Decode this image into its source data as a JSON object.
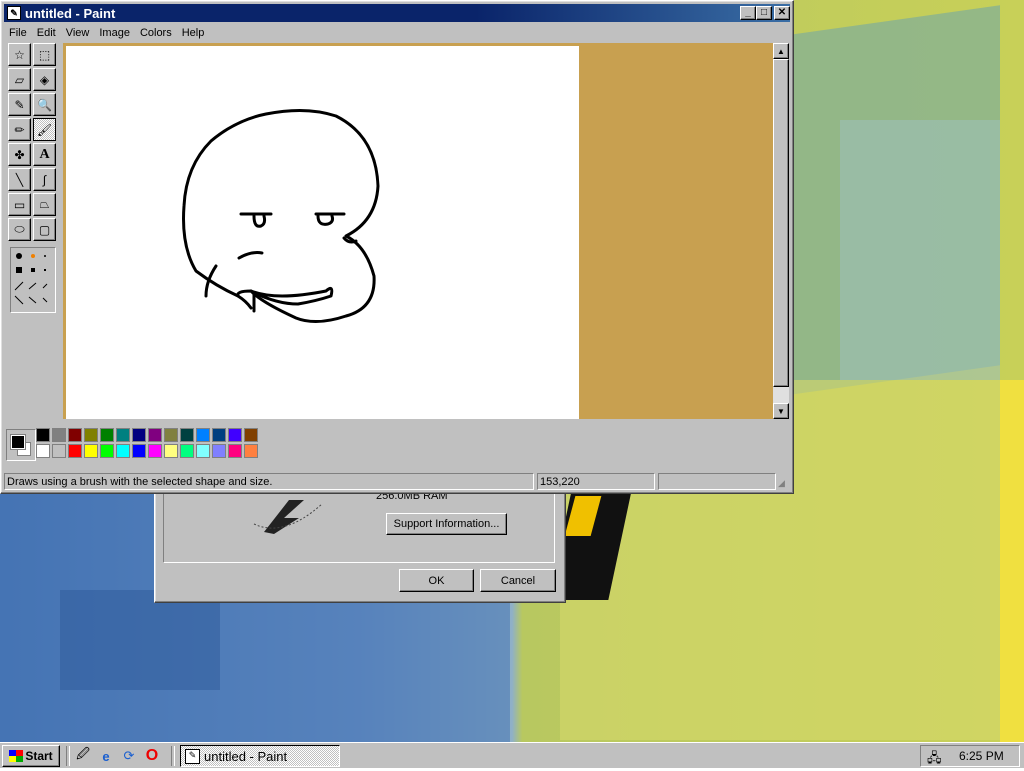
{
  "window": {
    "title": "untitled - Paint",
    "minimize_glyph": "_",
    "maximize_glyph": "□",
    "close_glyph": "✕"
  },
  "menu": [
    "File",
    "Edit",
    "View",
    "Image",
    "Colors",
    "Help"
  ],
  "tools": [
    {
      "name": "free-form-select",
      "glyph": "☆"
    },
    {
      "name": "select",
      "glyph": "⬚"
    },
    {
      "name": "eraser",
      "glyph": "▱"
    },
    {
      "name": "fill-with-color",
      "glyph": "◈"
    },
    {
      "name": "pick-color",
      "glyph": "✎"
    },
    {
      "name": "magnifier",
      "glyph": "🔍"
    },
    {
      "name": "pencil",
      "glyph": "✏"
    },
    {
      "name": "brush",
      "glyph": "🖌"
    },
    {
      "name": "airbrush",
      "glyph": "✤"
    },
    {
      "name": "text",
      "glyph": "A"
    },
    {
      "name": "line",
      "glyph": "╲"
    },
    {
      "name": "curve",
      "glyph": "∫"
    },
    {
      "name": "rectangle",
      "glyph": "▭"
    },
    {
      "name": "polygon",
      "glyph": "⏢"
    },
    {
      "name": "ellipse",
      "glyph": "⬭"
    },
    {
      "name": "rounded-rectangle",
      "glyph": "▢"
    }
  ],
  "palette": {
    "primary": "#000000",
    "secondary": "#ffffff",
    "row1": [
      "#000000",
      "#808080",
      "#800000",
      "#808000",
      "#008000",
      "#008080",
      "#000080",
      "#800080",
      "#808040",
      "#004040",
      "#0080ff",
      "#004080",
      "#4000ff",
      "#804000"
    ],
    "row2": [
      "#ffffff",
      "#c0c0c0",
      "#ff0000",
      "#ffff00",
      "#00ff00",
      "#00ffff",
      "#0000ff",
      "#ff00ff",
      "#ffff80",
      "#00ff80",
      "#80ffff",
      "#8080ff",
      "#ff0080",
      "#ff8040"
    ]
  },
  "status": {
    "help_text": "Draws using a brush with the selected shape and size.",
    "coordinates": "153,220",
    "size": ""
  },
  "dialog": {
    "partial_text": "256.0MB RAM",
    "support_button": "Support Information...",
    "ok_button": "OK",
    "cancel_button": "Cancel"
  },
  "taskbar": {
    "start_label": "Start",
    "task_label": "untitled - Paint",
    "clock": "6:25 PM"
  }
}
